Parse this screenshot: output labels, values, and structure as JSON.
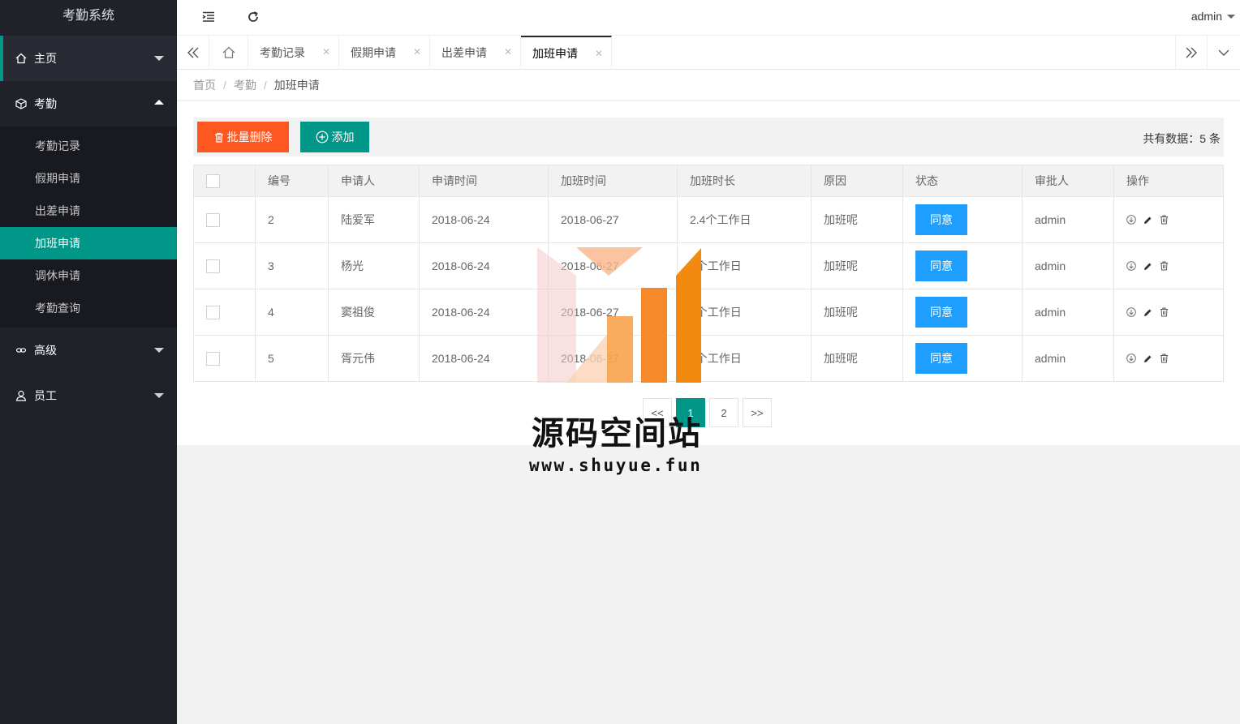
{
  "app": {
    "title": "考勤系统"
  },
  "sidebar": {
    "home": {
      "label": "主页"
    },
    "attendance": {
      "label": "考勤",
      "items": [
        {
          "label": "考勤记录"
        },
        {
          "label": "假期申请"
        },
        {
          "label": "出差申请"
        },
        {
          "label": "加班申请"
        },
        {
          "label": "调休申请"
        },
        {
          "label": "考勤查询"
        }
      ]
    },
    "advanced": {
      "label": "高级"
    },
    "staff": {
      "label": "员工"
    }
  },
  "header": {
    "user": "admin"
  },
  "tabs": [
    {
      "label": "考勤记录"
    },
    {
      "label": "假期申请"
    },
    {
      "label": "出差申请"
    },
    {
      "label": "加班申请"
    }
  ],
  "breadcrumb": {
    "home": "首页",
    "section": "考勤",
    "current": "加班申请"
  },
  "toolbar": {
    "delete_label": "批量删除",
    "add_label": "添加",
    "total_text": "共有数据：5 条"
  },
  "table": {
    "columns": [
      "编号",
      "申请人",
      "申请时间",
      "加班时间",
      "加班时长",
      "原因",
      "状态",
      "审批人",
      "操作"
    ],
    "rows": [
      {
        "id": "2",
        "applicant": "陆爱军",
        "apply_time": "2018-06-24",
        "ot_time": "2018-06-27",
        "duration": "2.4个工作日",
        "reason": "加班呢",
        "status": "同意",
        "approver": "admin"
      },
      {
        "id": "3",
        "applicant": "杨光",
        "apply_time": "2018-06-24",
        "ot_time": "2018-06-27",
        "duration": "5个工作日",
        "reason": "加班呢",
        "status": "同意",
        "approver": "admin"
      },
      {
        "id": "4",
        "applicant": "窦祖俊",
        "apply_time": "2018-06-24",
        "ot_time": "2018-06-27",
        "duration": "5个工作日",
        "reason": "加班呢",
        "status": "同意",
        "approver": "admin"
      },
      {
        "id": "5",
        "applicant": "胥元伟",
        "apply_time": "2018-06-24",
        "ot_time": "2018-06-27",
        "duration": "5个工作日",
        "reason": "加班呢",
        "status": "同意",
        "approver": "admin"
      }
    ]
  },
  "pagination": {
    "prev": "<<",
    "pages": [
      "1",
      "2"
    ],
    "next": ">>"
  },
  "watermark": {
    "text": "源码空间站",
    "url": "www.shuyue.fun"
  },
  "colors": {
    "sidebar": "#20222a",
    "accent": "#009688",
    "danger": "#ff5722",
    "status": "#1e9fff"
  }
}
